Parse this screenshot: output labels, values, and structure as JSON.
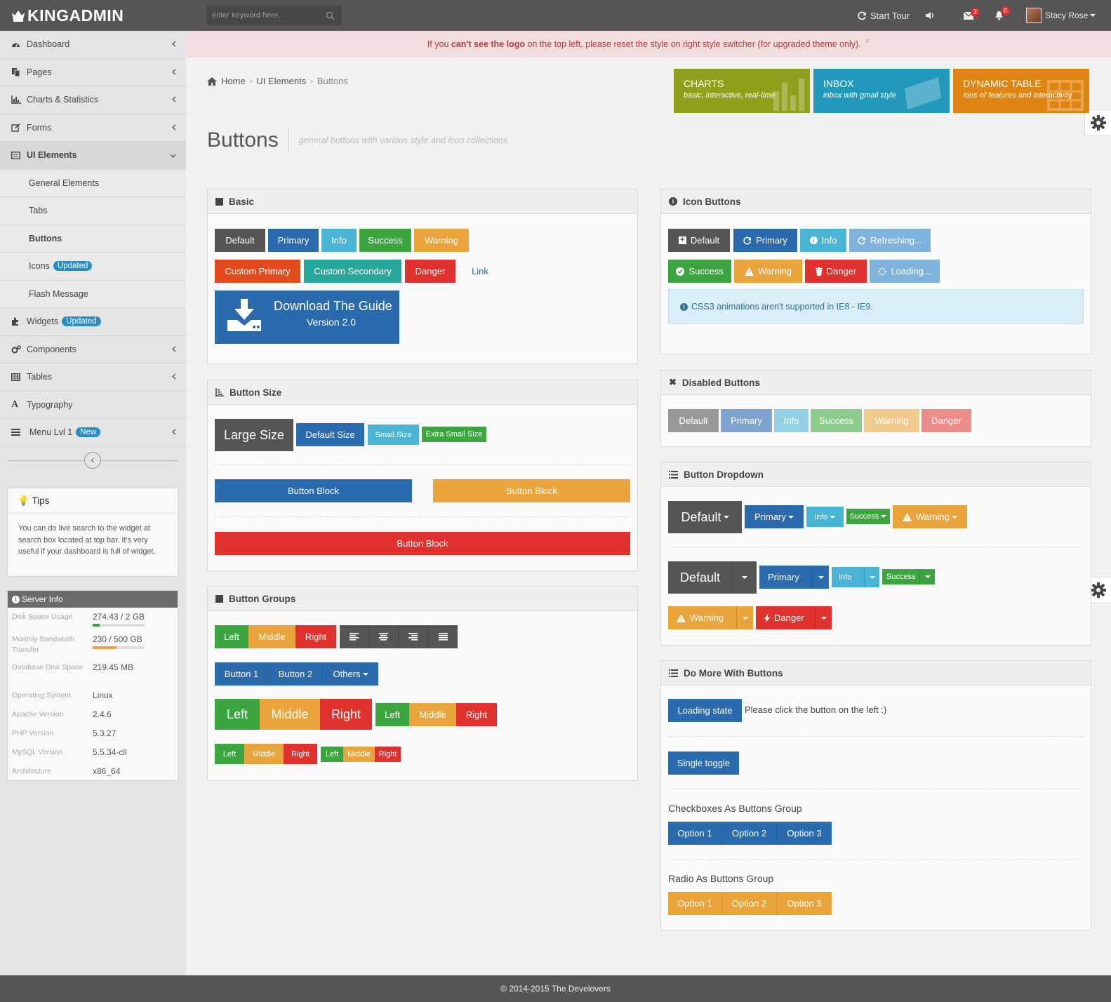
{
  "app": {
    "logo": "KINGADMIN"
  },
  "topbar": {
    "search_placeholder": "enter keyword here...",
    "start_tour": "Start Tour",
    "mail_count": "2",
    "notif_count": "8",
    "user_name": "Stacy Rose"
  },
  "sidebar": {
    "items": [
      {
        "label": "Dashboard",
        "icon": "dashboard-icon"
      },
      {
        "label": "Pages",
        "icon": "pages-icon"
      },
      {
        "label": "Charts & Statistics",
        "icon": "bar-chart-icon"
      },
      {
        "label": "Forms",
        "icon": "edit-icon"
      },
      {
        "label": "UI Elements",
        "icon": "list-alt-icon"
      }
    ],
    "subitems": [
      {
        "label": "General Elements"
      },
      {
        "label": "Tabs"
      },
      {
        "label": "Buttons"
      },
      {
        "label": "Icons",
        "pill": "Updated"
      },
      {
        "label": "Flash Message"
      }
    ],
    "items2": [
      {
        "label": "Widgets",
        "pill": "Updated",
        "icon": "puzzle-icon"
      },
      {
        "label": "Components",
        "icon": "cogs-icon"
      },
      {
        "label": "Tables",
        "icon": "table-icon"
      },
      {
        "label": "Typography",
        "icon": "font-icon"
      },
      {
        "label": "Menu Lvl 1",
        "pill": "New",
        "icon": "menu-icon"
      }
    ]
  },
  "tips": {
    "title": "Tips",
    "body": "You can do live search to the widget at search box located at top bar. It's very useful if your dashboard is full of widget."
  },
  "server": {
    "title": "Server Info",
    "rows": [
      {
        "k": "Disk Space Usage",
        "v": "274.43 / 2 GB",
        "progress": 0.14,
        "color": "#3da540"
      },
      {
        "k": "Monthly Bandwidth Transfer",
        "v": "230 / 500 GB",
        "progress": 0.46,
        "color": "#e9a43b"
      },
      {
        "k": "Database Disk Space",
        "v": "219.45 MB"
      },
      {
        "k": "Operating System",
        "v": "Linux"
      },
      {
        "k": "Apache Version",
        "v": "2.4.6"
      },
      {
        "k": "PHP Version",
        "v": "5.3.27"
      },
      {
        "k": "MySQL Version",
        "v": "5.5.34-cll"
      },
      {
        "k": "Architecture",
        "v": "x86_64"
      }
    ]
  },
  "alert": {
    "pre": "If you ",
    "bold": "can't see the logo",
    "post": " on the top left, please reset the style on right style switcher (for upgraded theme only).",
    "close": "×"
  },
  "breadcrumb": [
    "Home",
    "UI Elements",
    "Buttons"
  ],
  "tiles": [
    {
      "title": "CHARTS",
      "sub": "basic, interactive, real-time",
      "color": "#8fa11c"
    },
    {
      "title": "INBOX",
      "sub": "inbox with gmail style",
      "color": "#2299bb"
    },
    {
      "title": "DYNAMIC TABLE",
      "sub": "tons of features and interactivity",
      "color": "#e08513"
    }
  ],
  "page": {
    "title": "Buttons",
    "subtitle": "general buttons with various style and icon collections"
  },
  "basic": {
    "title": "Basic",
    "row1": [
      "Default",
      "Primary",
      "Info",
      "Success",
      "Warning"
    ],
    "row2": [
      "Custom Primary",
      "Custom Secondary",
      "Danger",
      "Link"
    ],
    "download": {
      "line1": "Download The Guide",
      "line2": "Version 2.0"
    }
  },
  "size": {
    "title": "Button Size",
    "buttons": [
      "Large Size",
      "Default Size",
      "Small Size",
      "Extra Small Size"
    ],
    "block": "Button Block"
  },
  "groups": {
    "title": "Button Groups",
    "lmr": [
      "Left",
      "Middle",
      "Right"
    ],
    "nav": [
      "Button 1",
      "Button 2",
      "Others"
    ]
  },
  "icon_buttons": {
    "title": "Icon Buttons",
    "row1": [
      "Default",
      "Primary",
      "Info",
      "Refreshing..."
    ],
    "row2": [
      "Success",
      "Warning",
      "Danger",
      "Loading..."
    ],
    "note": "CSS3 animations aren't supported in IE8 - IE9."
  },
  "disabled": {
    "title": "Disabled Buttons",
    "buttons": [
      "Default",
      "Primary",
      "Info",
      "Success",
      "Warning",
      "Danger"
    ]
  },
  "dropdown": {
    "title": "Button Dropdown",
    "row1": [
      "Default",
      "Primary",
      "Info",
      "Success",
      "Warning"
    ],
    "row2": [
      "Default",
      "Primary",
      "Info",
      "Success"
    ],
    "row3": [
      "Warning",
      "Danger"
    ]
  },
  "more": {
    "title": "Do More With Buttons",
    "loading_btn": "Loading state",
    "loading_note": "Please click the button on the left :)",
    "toggle": "Single toggle",
    "checkbox_label": "Checkboxes As Buttons Group",
    "options": [
      "Option 1",
      "Option 2",
      "Option 3"
    ],
    "radio_label": "Radio As Buttons Group"
  },
  "footer": {
    "text": "© 2014-2015 The Develovers"
  }
}
